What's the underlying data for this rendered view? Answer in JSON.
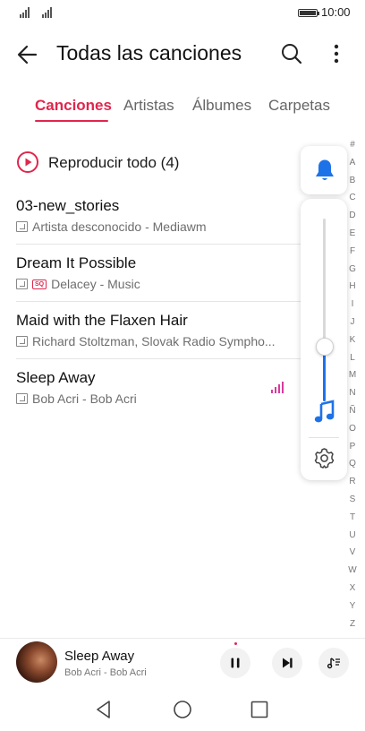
{
  "status_bar": {
    "time": "10:00",
    "battery_level": 1.0
  },
  "header": {
    "title": "Todas las canciones"
  },
  "tabs": [
    {
      "label": "Canciones",
      "active": true
    },
    {
      "label": "Artistas",
      "active": false
    },
    {
      "label": "Álbumes",
      "active": false
    },
    {
      "label": "Carpetas",
      "active": false
    }
  ],
  "play_all": {
    "label": "Reproducir todo (4)"
  },
  "songs": [
    {
      "title": "03-new_stories",
      "subtitle": "Artista desconocido - Mediawm",
      "sq": false,
      "playing": false
    },
    {
      "title": "Dream It Possible",
      "subtitle": "Delacey - Music",
      "sq": true,
      "sq_label": "SQ",
      "playing": false
    },
    {
      "title": "Maid with the Flaxen Hair",
      "subtitle": "Richard Stoltzman, Slovak Radio Sympho...",
      "sq": false,
      "playing": false
    },
    {
      "title": "Sleep Away",
      "subtitle": "Bob Acri - Bob Acri",
      "sq": false,
      "playing": true
    }
  ],
  "alpha_index": [
    "#",
    "A",
    "B",
    "C",
    "D",
    "E",
    "F",
    "G",
    "H",
    "I",
    "J",
    "K",
    "L",
    "M",
    "N",
    "Ñ",
    "O",
    "P",
    "Q",
    "R",
    "S",
    "T",
    "U",
    "V",
    "W",
    "X",
    "Y",
    "Z"
  ],
  "volume_panel": {
    "volume_level": 0.3
  },
  "now_playing": {
    "title": "Sleep Away",
    "subtitle": "Bob Acri - Bob Acri",
    "state": "playing"
  },
  "colors": {
    "accent": "#e0264d",
    "volume_blue": "#1e72e8",
    "playing_indicator": "#d83a9e"
  }
}
